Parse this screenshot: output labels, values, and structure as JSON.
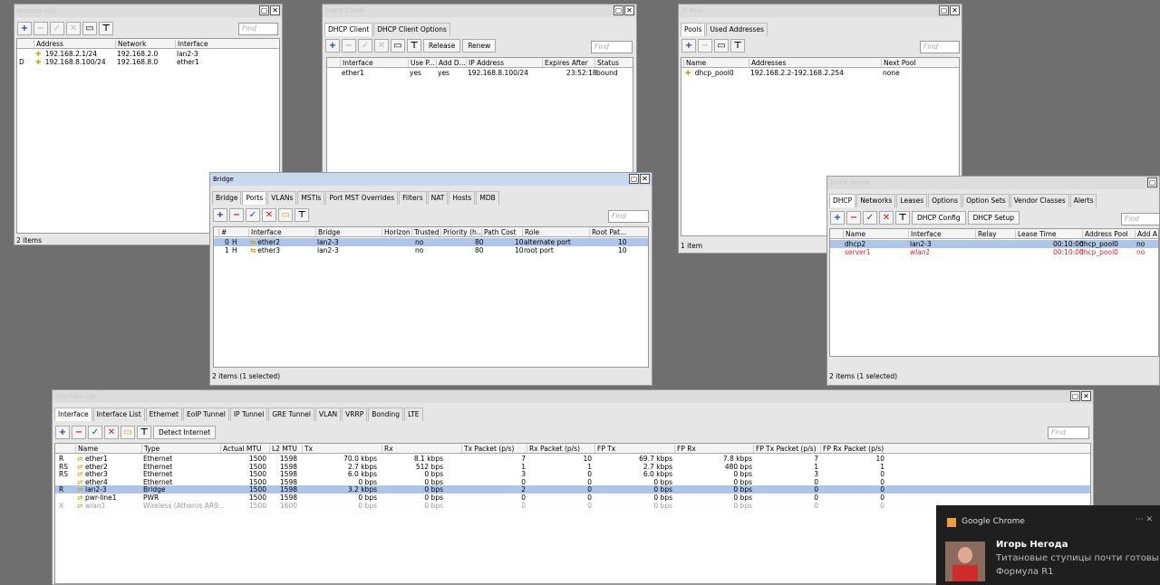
{
  "address_list": {
    "title": "Address List",
    "find": "Find",
    "cols": [
      "Address",
      "Network",
      "Interface"
    ],
    "rows": [
      {
        "flag": "",
        "addr": "192.168.2.1/24",
        "net": "192.168.2.0",
        "iface": "lan2-3"
      },
      {
        "flag": "D",
        "addr": "192.168.8.100/24",
        "net": "192.168.8.0",
        "iface": "ether1"
      }
    ],
    "status": "2 items"
  },
  "dhcp_client": {
    "title": "DHCP Client",
    "tabs": [
      "DHCP Client",
      "DHCP Client Options"
    ],
    "btn_release": "Release",
    "btn_renew": "Renew",
    "find": "Find",
    "cols": [
      "Interface",
      "Use P...",
      "Add D...",
      "IP Address",
      "Expires After",
      "Status"
    ],
    "rows": [
      {
        "iface": "ether1",
        "use": "yes",
        "add": "yes",
        "ip": "192.168.8.100/24",
        "exp": "23:52:18",
        "status": "bound"
      }
    ]
  },
  "ip_pool": {
    "title": "IP Pool",
    "tabs": [
      "Pools",
      "Used Addresses"
    ],
    "find": "Find",
    "cols": [
      "Name",
      "Addresses",
      "Next Pool"
    ],
    "rows": [
      {
        "name": "dhcp_pool0",
        "addr": "192.168.2.2-192.168.2.254",
        "next": "none"
      }
    ],
    "status": "1 item"
  },
  "bridge": {
    "title": "Bridge",
    "tabs": [
      "Bridge",
      "Ports",
      "VLANs",
      "MSTIs",
      "Port MST Overrides",
      "Filters",
      "NAT",
      "Hosts",
      "MDB"
    ],
    "find": "Find",
    "cols": [
      "#",
      "Interface",
      "Bridge",
      "Horizon",
      "Trusted",
      "Priority (h...",
      "Path Cost",
      "Role",
      "Root Pat..."
    ],
    "rows": [
      {
        "n": "0",
        "f": "H",
        "iface": "ether2",
        "bridge": "lan2-3",
        "trusted": "no",
        "prio": "80",
        "cost": "10",
        "role": "alternate port",
        "root": "10"
      },
      {
        "n": "1",
        "f": "H",
        "iface": "ether3",
        "bridge": "lan2-3",
        "trusted": "no",
        "prio": "80",
        "cost": "10",
        "role": "root port",
        "root": "10"
      }
    ],
    "status": "2 items (1 selected)"
  },
  "dhcp_server": {
    "title": "DHCP Server",
    "tabs": [
      "DHCP",
      "Networks",
      "Leases",
      "Options",
      "Option Sets",
      "Vendor Classes",
      "Alerts"
    ],
    "btn_config": "DHCP Config",
    "btn_setup": "DHCP Setup",
    "find": "Find",
    "cols": [
      "Name",
      "Interface",
      "Relay",
      "Lease Time",
      "Address Pool",
      "Add A"
    ],
    "rows": [
      {
        "name": "dhcp2",
        "iface": "lan2-3",
        "lease": "00:10:00",
        "pool": "dhcp_pool0",
        "add": "no"
      },
      {
        "name": "server1",
        "iface": "wlan1",
        "lease": "00:10:00",
        "pool": "dhcp_pool0",
        "add": "no"
      }
    ],
    "status": "2 items (1 selected)"
  },
  "interface_list": {
    "title": "Interface List",
    "tabs": [
      "Interface",
      "Interface List",
      "Ethernet",
      "EoIP Tunnel",
      "IP Tunnel",
      "GRE Tunnel",
      "VLAN",
      "VRRP",
      "Bonding",
      "LTE"
    ],
    "btn_detect": "Detect Internet",
    "find": "Find",
    "cols": [
      "Name",
      "Type",
      "Actual MTU",
      "L2 MTU",
      "Tx",
      "Rx",
      "Tx Packet (p/s)",
      "Rx Packet (p/s)",
      "FP Tx",
      "FP Rx",
      "FP Tx Packet (p/s)",
      "FP Rx Packet (p/s)"
    ],
    "rows": [
      {
        "flag": "R",
        "name": "ether1",
        "type": "Ethernet",
        "mtu": "1500",
        "l2": "1598",
        "tx": "70.0 kbps",
        "rx": "8.1 kbps",
        "txp": "7",
        "rxp": "10",
        "fptx": "69.7 kbps",
        "fprx": "7.8 kbps",
        "fptxp": "7",
        "fprxp": "10"
      },
      {
        "flag": "RS",
        "name": "ether2",
        "type": "Ethernet",
        "mtu": "1500",
        "l2": "1598",
        "tx": "2.7 kbps",
        "rx": "512 bps",
        "txp": "1",
        "rxp": "1",
        "fptx": "2.7 kbps",
        "fprx": "480 bps",
        "fptxp": "1",
        "fprxp": "1"
      },
      {
        "flag": "RS",
        "name": "ether3",
        "type": "Ethernet",
        "mtu": "1500",
        "l2": "1598",
        "tx": "6.0 kbps",
        "rx": "0 bps",
        "txp": "3",
        "rxp": "0",
        "fptx": "6.0 kbps",
        "fprx": "0 bps",
        "fptxp": "3",
        "fprxp": "0"
      },
      {
        "flag": "",
        "name": "ether4",
        "type": "Ethernet",
        "mtu": "1500",
        "l2": "1598",
        "tx": "0 bps",
        "rx": "0 bps",
        "txp": "0",
        "rxp": "0",
        "fptx": "0 bps",
        "fprx": "0 bps",
        "fptxp": "0",
        "fprxp": "0"
      },
      {
        "flag": "R",
        "name": "lan2-3",
        "type": "Bridge",
        "mtu": "1500",
        "l2": "1598",
        "tx": "3.2 kbps",
        "rx": "0 bps",
        "txp": "2",
        "rxp": "0",
        "fptx": "0 bps",
        "fprx": "0 bps",
        "fptxp": "0",
        "fprxp": "0"
      },
      {
        "flag": "",
        "name": "pwr-line1",
        "type": "PWR",
        "mtu": "1500",
        "l2": "1598",
        "tx": "0 bps",
        "rx": "0 bps",
        "txp": "0",
        "rxp": "0",
        "fptx": "0 bps",
        "fprx": "0 bps",
        "fptxp": "0",
        "fprxp": "0"
      },
      {
        "flag": "X",
        "name": "wlan1",
        "type": "Wireless (Atheros AR9...",
        "mtu": "1500",
        "l2": "1600",
        "tx": "0 bps",
        "rx": "0 bps",
        "txp": "0",
        "rxp": "0",
        "fptx": "0 bps",
        "fprx": "0 bps",
        "fptxp": "0",
        "fprxp": "0"
      }
    ]
  },
  "notification": {
    "app": "Google Chrome",
    "sender": "Игорь Негода",
    "line1": "Титановые ступицы почти готовы -",
    "line2": "Формула R1"
  }
}
